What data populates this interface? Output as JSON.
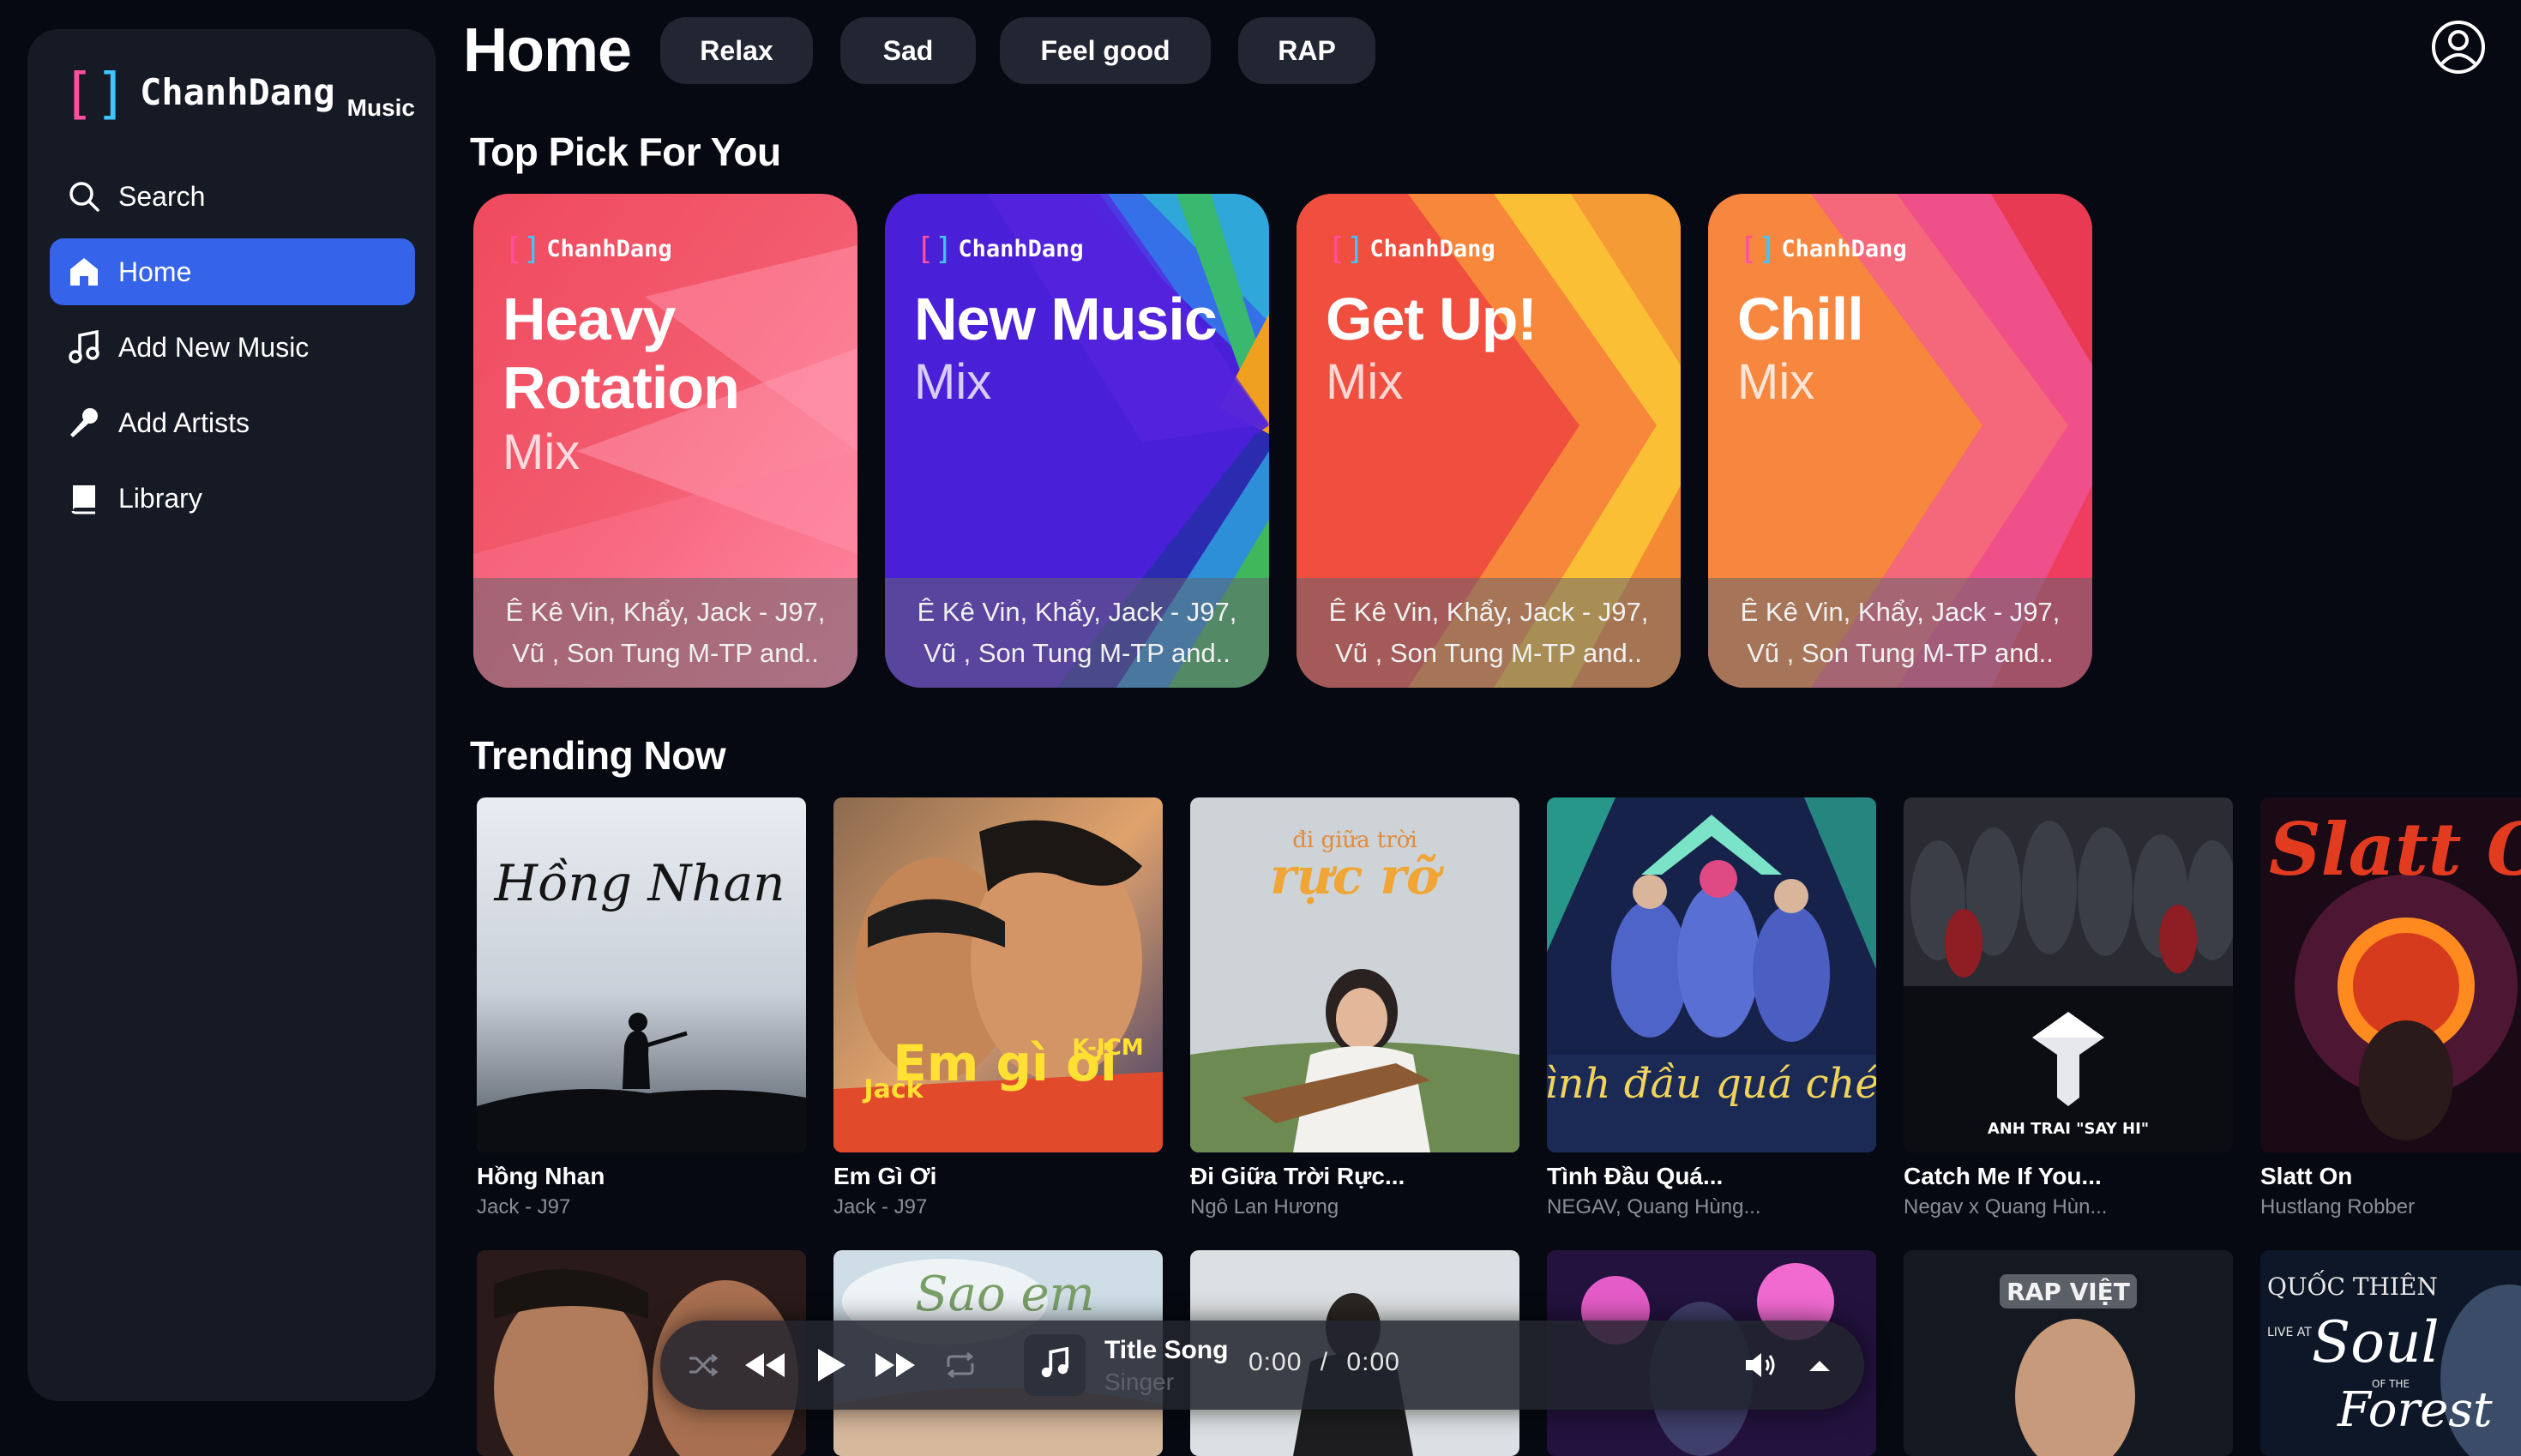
{
  "brand": {
    "bracket_left": "[",
    "bracket_right": "]",
    "name": "ChanhDang",
    "sub": "Music"
  },
  "nav": [
    {
      "label": "Search",
      "icon": "search-icon",
      "active": false
    },
    {
      "label": "Home",
      "icon": "home-icon",
      "active": true
    },
    {
      "label": "Add New Music",
      "icon": "music-note-icon",
      "active": false
    },
    {
      "label": "Add Artists",
      "icon": "microphone-icon",
      "active": false
    },
    {
      "label": "Library",
      "icon": "book-icon",
      "active": false
    }
  ],
  "header": {
    "title": "Home",
    "chips": [
      "Relax",
      "Sad",
      "Feel good",
      "RAP"
    ],
    "user_icon": "user-circle-icon"
  },
  "top_pick": {
    "title": "Top Pick For You",
    "cards": [
      {
        "brand": "ChanhDang",
        "title_lines": [
          "Heavy",
          "Rotation"
        ],
        "subtitle": "Mix",
        "artists_line1": "Ê Kê Vin, Khẩy, Jack - J97,",
        "artists_line2": "Vũ , Son Tung M-TP and.."
      },
      {
        "brand": "ChanhDang",
        "title_lines": [
          "New Music"
        ],
        "subtitle": "Mix",
        "artists_line1": "Ê Kê Vin, Khẩy, Jack - J97,",
        "artists_line2": "Vũ , Son Tung M-TP and.."
      },
      {
        "brand": "ChanhDang",
        "title_lines": [
          "Get Up!"
        ],
        "subtitle": "Mix",
        "artists_line1": "Ê Kê Vin, Khẩy, Jack - J97,",
        "artists_line2": "Vũ , Son Tung M-TP and.."
      },
      {
        "brand": "ChanhDang",
        "title_lines": [
          "Chill"
        ],
        "subtitle": "Mix",
        "artists_line1": "Ê Kê Vin, Khẩy, Jack - J97,",
        "artists_line2": "Vũ , Son Tung M-TP and.."
      }
    ]
  },
  "trending": {
    "title": "Trending Now",
    "tracks": [
      {
        "title": "Hồng Nhan",
        "artist": "Jack - J97",
        "cover_text": "Hồng Nhan"
      },
      {
        "title": "Em Gì Ơi",
        "artist": "Jack - J97",
        "cover_text": "Em gì ơi",
        "cover_text2": "Jack",
        "cover_text3": "K-ICM"
      },
      {
        "title": "Đi Giữa Trời Rực...",
        "artist": "Ngô Lan Hương",
        "cover_text": "đi giữa trời",
        "cover_text2": "rực rỡ"
      },
      {
        "title": "Tình Đầu Quá...",
        "artist": "NEGAV, Quang Hùng...",
        "cover_text": "Tình đầu quá chén"
      },
      {
        "title": "Catch Me If You...",
        "artist": "Negav x Quang Hùn...",
        "cover_text": "ANH TRAI \"SAY HI\""
      },
      {
        "title": "Slatt On",
        "artist": "Hustlang Robber",
        "cover_text": "Slatt O"
      }
    ],
    "row2_cover_text": [
      "",
      "Sao em",
      "",
      "",
      "RAP VIỆT",
      "QUỐC THIÊN",
      "LIVE AT",
      "Soul",
      "OF THE",
      "Forest"
    ]
  },
  "player": {
    "title": "Title Song",
    "singer": "Singer",
    "current": "0:00",
    "separator": "/",
    "duration": "0:00",
    "icons": [
      "shuffle-icon",
      "rewind-icon",
      "play-icon",
      "fast-forward-icon",
      "repeat-icon",
      "music-note-icon",
      "volume-icon",
      "expand-up-icon"
    ]
  },
  "colors": {
    "accent": "#3563e9",
    "background": "#070912",
    "sidebar": "#161a24",
    "chip": "#222633"
  }
}
